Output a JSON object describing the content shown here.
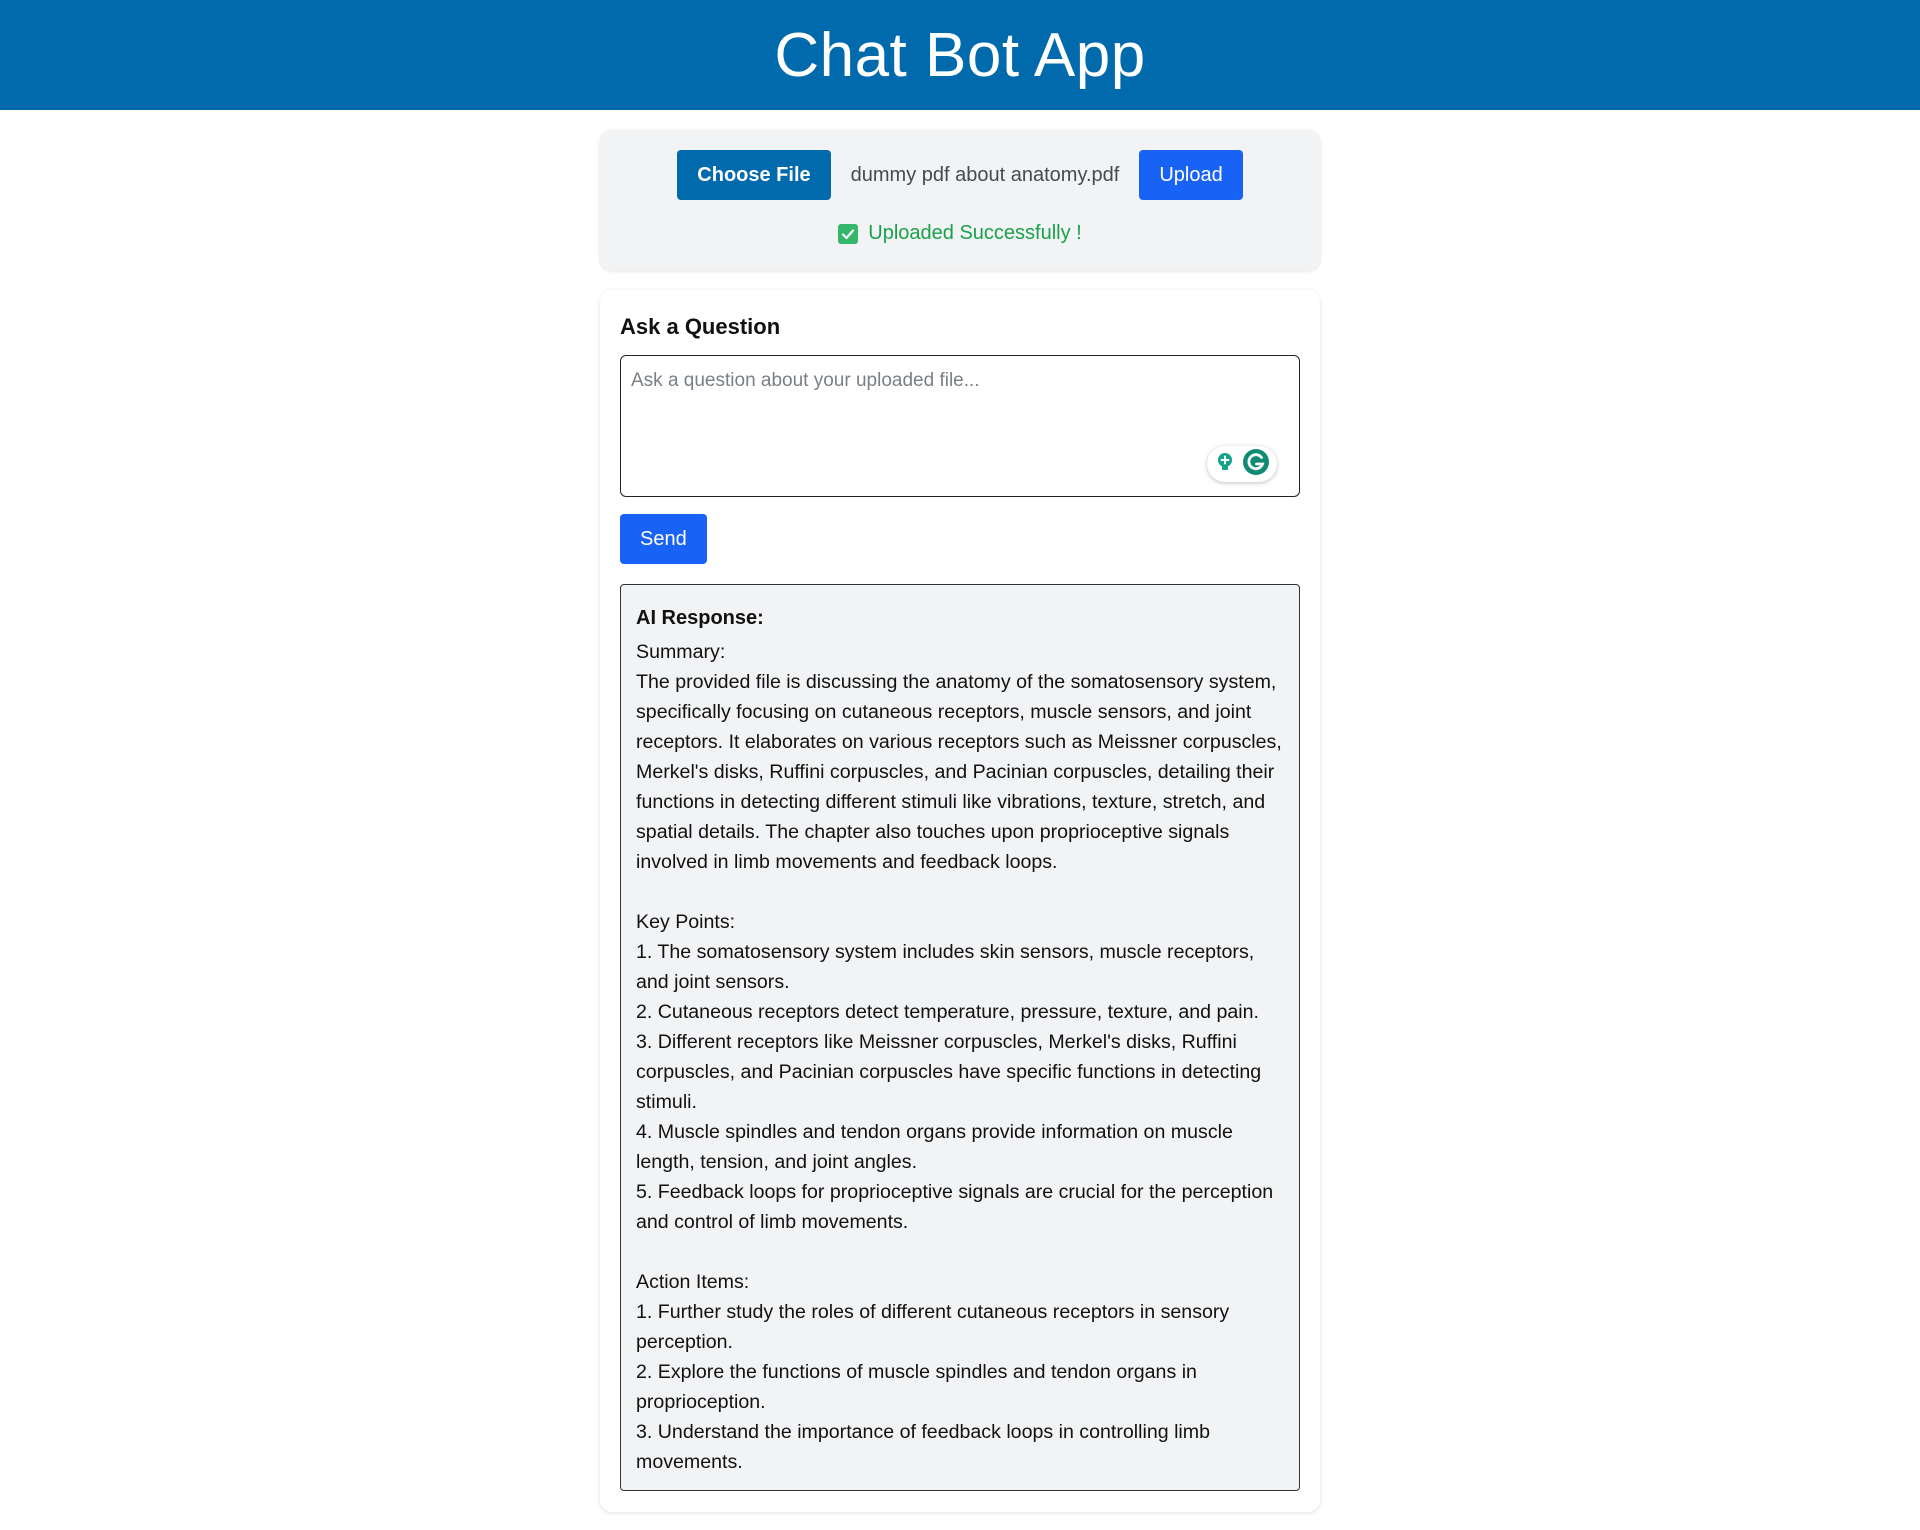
{
  "header": {
    "title": "Chat Bot App",
    "background": "#016aad"
  },
  "upload": {
    "choose_label": "Choose File",
    "file_name": "dummy pdf about anatomy.pdf",
    "upload_label": "Upload",
    "status_text": "Uploaded Successfully !",
    "status_color": "#19a04a"
  },
  "question": {
    "heading": "Ask a Question",
    "placeholder": "Ask a question about your uploaded file...",
    "value": "",
    "send_label": "Send"
  },
  "response": {
    "label": "AI Response:",
    "text": "Summary:\nThe provided file is discussing the anatomy of the somatosensory system, specifically focusing on cutaneous receptors, muscle sensors, and joint receptors. It elaborates on various receptors such as Meissner corpuscles, Merkel's disks, Ruffini corpuscles, and Pacinian corpuscles, detailing their functions in detecting different stimuli like vibrations, texture, stretch, and spatial details. The chapter also touches upon proprioceptive signals involved in limb movements and feedback loops.\n\nKey Points:\n1. The somatosensory system includes skin sensors, muscle receptors, and joint sensors.\n2. Cutaneous receptors detect temperature, pressure, texture, and pain.\n3. Different receptors like Meissner corpuscles, Merkel's disks, Ruffini corpuscles, and Pacinian corpuscles have specific functions in detecting stimuli.\n4. Muscle spindles and tendon organs provide information on muscle length, tension, and joint angles.\n5. Feedback loops for proprioceptive signals are crucial for the perception and control of limb movements.\n\nAction Items:\n1. Further study the roles of different cutaneous receptors in sensory perception.\n2. Explore the functions of muscle spindles and tendon organs in proprioception.\n3. Understand the importance of feedback loops in controlling limb movements."
  },
  "icons": {
    "status": "check-icon",
    "writing_assist": "lightbulb-icon",
    "grammar_assist": "grammarly-g-icon"
  },
  "colors": {
    "primary_button": "#1962f6",
    "choose_button": "#016aad",
    "card_background": "#f2f3f5"
  }
}
